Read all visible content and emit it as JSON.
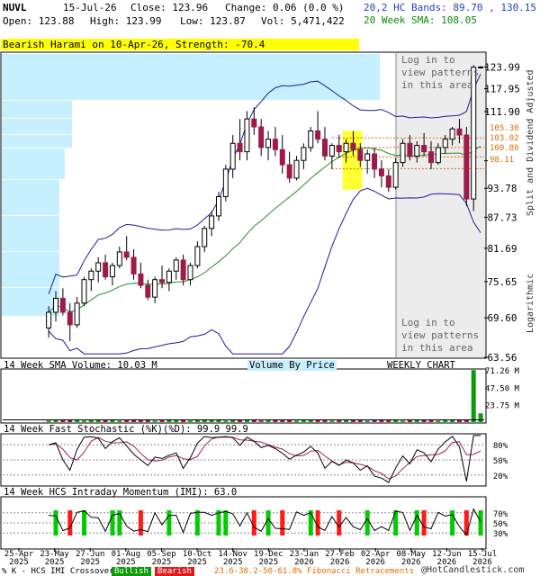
{
  "header": {
    "ticker": "NUVL",
    "date": "15-Jul-26",
    "close_label": "Close:",
    "close": "123.96",
    "change_label": "Change:",
    "change": "0.06 (0.0 %)",
    "open_label": "Open:",
    "open": "123.88",
    "high_label": "High:",
    "high": "123.99",
    "low_label": "Low:",
    "low": "123.87",
    "vol_label": "Vol:",
    "vol": "5,471,422",
    "bands_text": "20,2 HC Bands: 89.70 , 130.15",
    "sma_text": "20 Week SMA: 108.05"
  },
  "pattern_banner": "Bearish Harami on 10-Apr-26, Strength: -70.4",
  "login_top": "Log in to view patterns in this area",
  "login_bottom": "Log in to view patterns in this area",
  "right_axis_label": "Split and Dividend Adjusted",
  "right_axis_label2": "Logarithmic",
  "fib_labels": [
    "105.30",
    "103.02",
    "100.80",
    "98.11"
  ],
  "panels": {
    "volume_title": "14 Week SMA Volume: 10.03 M",
    "volume_by_price": "Volume By Price",
    "weekly_chart": "WEEKLY CHART",
    "stoch_title": "14 Week Fast Stochastic (%K)(%D): 99.9  99.9",
    "imi_title": "14 Week HCS Intraday Momentum (IMI): 63.0"
  },
  "footer": {
    "left_text": "% K - HCS IMI Crossover:",
    "bullish": "Bullish",
    "bearish": "Bearish",
    "fib_text": "23.6-38.2-50-61.8% Fibonacci Retracements",
    "brand": "@HotCandlestick.com"
  },
  "colors": {
    "bull": "#0a9a0a",
    "bear": "#9e1a4a",
    "band": "#1a1aa0",
    "sma": "#2a8a2a",
    "vbp": "#c6f0ff",
    "fib": "#e06a00",
    "highlight": "#ffff33",
    "stoch_fill": "#d8cfa0",
    "imi_green": "#00cc00",
    "imi_red": "#ff1a1a"
  },
  "chart_data": {
    "type": "candlestick",
    "scale": "logarithmic",
    "y_ticks": [
      123.99,
      117.95,
      111.9,
      99.91,
      93.78,
      87.73,
      81.69,
      75.65,
      69.6,
      63.56
    ],
    "y_tick_labels": [
      "123.99",
      "117.95",
      "111.90",
      "",
      "93.78",
      "87.73",
      "81.69",
      "75.65",
      "69.60",
      "63.56"
    ],
    "ylim": [
      63.56,
      128.0
    ],
    "x_tick_labels": [
      "25-Apr\n2025",
      "23-May\n2025",
      "27-Jun\n2025",
      "01-Aug\n2025",
      "05-Sep\n2025",
      "10-Oct\n2025",
      "14-Nov\n2025",
      "19-Dec\n2025",
      "23-Jan\n2026",
      "27-Feb\n2026",
      "02-Apr\n2026",
      "08-May\n2026",
      "12-Jun\n2026",
      "15-Jul\n2026"
    ],
    "weeks": 68,
    "candles": [
      [
        68.0,
        71.5,
        66.5,
        70.5
      ],
      [
        70.5,
        74.0,
        69.0,
        72.8
      ],
      [
        72.8,
        74.5,
        70.0,
        70.5
      ],
      [
        70.5,
        72.0,
        66.0,
        68.5
      ],
      [
        68.5,
        73.0,
        68.0,
        72.0
      ],
      [
        72.0,
        76.5,
        71.5,
        76.0
      ],
      [
        76.0,
        78.0,
        74.0,
        77.5
      ],
      [
        77.5,
        80.0,
        75.5,
        79.0
      ],
      [
        79.0,
        80.5,
        76.0,
        76.5
      ],
      [
        76.5,
        79.0,
        75.0,
        78.5
      ],
      [
        78.5,
        82.0,
        78.0,
        81.0
      ],
      [
        81.0,
        84.0,
        79.5,
        80.0
      ],
      [
        80.0,
        81.5,
        76.0,
        77.0
      ],
      [
        77.0,
        79.0,
        74.5,
        75.0
      ],
      [
        75.0,
        76.0,
        72.5,
        73.0
      ],
      [
        73.0,
        76.5,
        72.0,
        76.0
      ],
      [
        76.0,
        78.5,
        74.5,
        75.5
      ],
      [
        75.5,
        78.0,
        74.0,
        77.5
      ],
      [
        77.5,
        80.0,
        76.0,
        79.5
      ],
      [
        79.5,
        80.5,
        75.0,
        76.0
      ],
      [
        76.0,
        79.0,
        75.0,
        78.5
      ],
      [
        78.5,
        83.0,
        78.0,
        82.0
      ],
      [
        82.0,
        86.0,
        81.0,
        85.5
      ],
      [
        85.5,
        89.0,
        84.0,
        88.0
      ],
      [
        88.0,
        93.0,
        87.0,
        92.0
      ],
      [
        92.0,
        99.0,
        91.0,
        98.0
      ],
      [
        98.0,
        106.0,
        96.0,
        104.0
      ],
      [
        104.0,
        110.0,
        100.0,
        102.0
      ],
      [
        102.0,
        112.0,
        100.0,
        110.0
      ],
      [
        110.0,
        113.0,
        106.0,
        108.0
      ],
      [
        108.0,
        110.0,
        101.0,
        103.0
      ],
      [
        103.0,
        107.0,
        100.0,
        105.0
      ],
      [
        105.0,
        108.0,
        101.0,
        102.5
      ],
      [
        102.5,
        106.0,
        97.0,
        99.0
      ],
      [
        99.0,
        102.0,
        95.0,
        96.0
      ],
      [
        96.0,
        101.0,
        95.5,
        100.0
      ],
      [
        100.0,
        104.0,
        98.0,
        103.0
      ],
      [
        103.0,
        108.0,
        102.0,
        107.0
      ],
      [
        107.0,
        112.0,
        104.0,
        105.0
      ],
      [
        105.0,
        108.0,
        100.0,
        101.0
      ],
      [
        101.0,
        104.0,
        98.0,
        103.5
      ],
      [
        103.5,
        106.0,
        100.5,
        102.0
      ],
      [
        102.0,
        105.0,
        99.5,
        104.0
      ],
      [
        104.0,
        107.0,
        101.0,
        102.5
      ],
      [
        102.5,
        104.0,
        98.5,
        100.0
      ],
      [
        100.0,
        102.5,
        97.0,
        101.5
      ],
      [
        101.5,
        103.0,
        96.0,
        98.0
      ],
      [
        98.0,
        100.0,
        94.0,
        96.5
      ],
      [
        96.5,
        98.0,
        93.0,
        94.0
      ],
      [
        94.0,
        100.5,
        93.5,
        99.5
      ],
      [
        99.5,
        105.0,
        98.5,
        104.0
      ],
      [
        104.0,
        106.0,
        100.0,
        101.0
      ],
      [
        101.0,
        104.5,
        99.5,
        103.5
      ],
      [
        103.5,
        106.5,
        101.0,
        102.0
      ],
      [
        102.0,
        104.5,
        98.0,
        99.5
      ],
      [
        99.5,
        104.0,
        99.0,
        103.0
      ],
      [
        103.0,
        106.0,
        101.5,
        105.0
      ],
      [
        105.0,
        108.0,
        103.5,
        107.5
      ],
      [
        107.5,
        110.0,
        104.0,
        106.0
      ],
      [
        106.0,
        108.0,
        90.0,
        91.5
      ],
      [
        91.5,
        124.5,
        89.0,
        123.9
      ],
      [
        123.9,
        124.2,
        123.5,
        123.96
      ]
    ],
    "volume_ylim": [
      0,
      71.26
    ],
    "volume_ticks": [
      "71.26 M",
      "47.50 M",
      "23.75 M"
    ],
    "volume_tick_values": [
      71.26,
      47.5,
      23.75
    ],
    "stoch_ticks": [
      "80%",
      "50%",
      "20%"
    ],
    "stoch_tick_values": [
      80,
      50,
      20
    ],
    "imi_ticks": [
      "70%",
      "50%",
      "30%"
    ],
    "imi_tick_values": [
      70,
      50,
      30
    ]
  }
}
